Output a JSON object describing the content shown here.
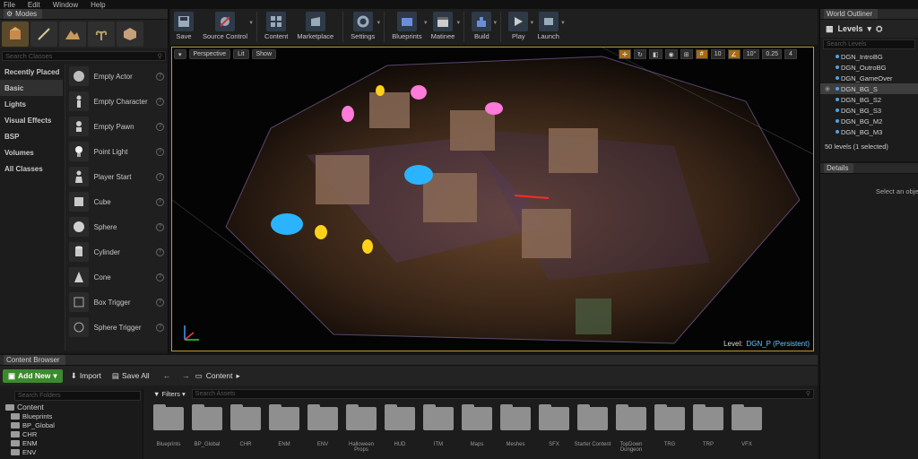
{
  "menu": [
    "File",
    "Edit",
    "Window",
    "Help"
  ],
  "modes": {
    "tab_label": "Modes",
    "search_placeholder": "Search Classes",
    "categories": [
      "Recently Placed",
      "Basic",
      "Lights",
      "Visual Effects",
      "BSP",
      "Volumes",
      "All Classes"
    ],
    "selected_category": "Basic",
    "items": [
      "Empty Actor",
      "Empty Character",
      "Empty Pawn",
      "Point Light",
      "Player Start",
      "Cube",
      "Sphere",
      "Cylinder",
      "Cone",
      "Box Trigger",
      "Sphere Trigger"
    ]
  },
  "toolbar": {
    "buttons": [
      "Save",
      "Source Control",
      "Content",
      "Marketplace",
      "Settings",
      "Blueprints",
      "Matinee",
      "Build",
      "Play",
      "Launch"
    ]
  },
  "viewport": {
    "perspective": "Perspective",
    "lit": "Lit",
    "show": "Show",
    "snap_grid": "10",
    "snap_rot": "10°",
    "snap_scale": "0.25",
    "cam_speed": "4",
    "level_label": "Level:",
    "level_name": "DGN_P (Persistent)"
  },
  "outliner": {
    "tab_label": "World Outliner",
    "levels_label": "Levels",
    "search_placeholder": "Search Levels",
    "levels": [
      "DGN_IntroBG",
      "DGN_OutroBG",
      "DGN_GameOver",
      "DGN_BG_S",
      "DGN_BG_S2",
      "DGN_BG_S3",
      "DGN_BG_M2",
      "DGN_BG_M3"
    ],
    "selected_level": "DGN_BG_S",
    "count_text": "50 levels (1 selected)"
  },
  "details": {
    "tab_label": "Details",
    "empty_message": "Select an object"
  },
  "content_browser": {
    "tab_label": "Content Browser",
    "add_new": "Add New",
    "import": "Import",
    "save_all": "Save All",
    "path": "Content",
    "folder_search_placeholder": "Search Folders",
    "filters": "Filters",
    "asset_search_placeholder": "Search Assets",
    "tree": [
      "Content",
      "Blueprints",
      "BP_Global",
      "CHR",
      "ENM",
      "ENV"
    ],
    "assets": [
      "Blueprints",
      "BP_Global",
      "CHR",
      "ENM",
      "ENV",
      "Halloween Props",
      "HUD",
      "ITM",
      "Maps",
      "Meshes",
      "SFX",
      "Starter Content",
      "TopDown Dungeon",
      "TRG",
      "TRP",
      "VFX"
    ]
  },
  "colors": {
    "accent": "#b99a3a",
    "add_new_green": "#3c8a2e",
    "level_blue": "#63c8ff",
    "snap_orange": "#a66a10"
  }
}
